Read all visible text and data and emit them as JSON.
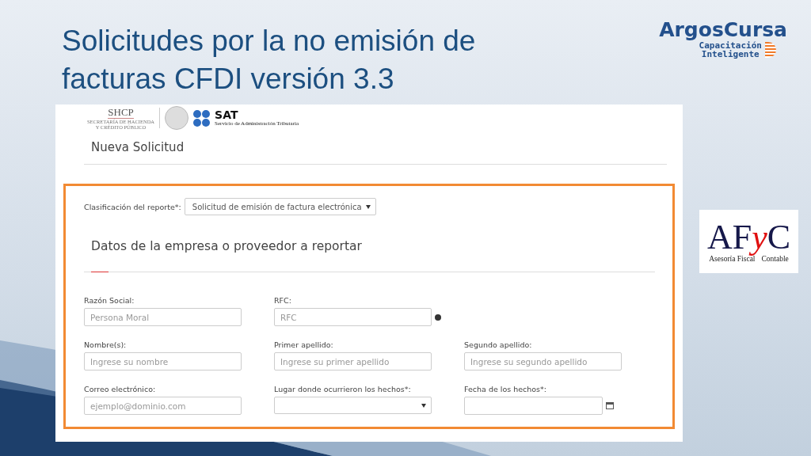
{
  "slide": {
    "title_lines": [
      "Solicitudes por la no emisión de",
      "facturas CFDI versión 3.3"
    ]
  },
  "brand_logo": {
    "name": "ArgosCursa",
    "tagline_lines": [
      "Capacitación",
      "Inteligente"
    ]
  },
  "partner_logo": {
    "mark_left": "AF",
    "mark_middle": "y",
    "mark_right": "C",
    "caption_left": "Asesoría Fiscal",
    "caption_right": "Contable"
  },
  "web_page": {
    "header": {
      "shcp": "SHCP",
      "shcp_caption_lines": [
        "SECRETARÍA DE HACIENDA",
        "Y CRÉDITO PÚBLICO"
      ],
      "sat": "SAT",
      "sat_caption": "Servicio de Administración Tributaria"
    },
    "page_title": "Nueva Solicitud",
    "classification": {
      "label": "Clasificación del reporte*:",
      "value": "Solicitud de emisión de factura electrónica"
    },
    "section_title": "Datos de la empresa o proveedor a reportar",
    "field_rows": [
      [
        {
          "kind": "text",
          "label": "Razón Social:",
          "placeholder": "Persona Moral",
          "has_help": false
        },
        {
          "kind": "text",
          "label": "RFC:",
          "placeholder": "RFC",
          "has_help": true
        }
      ],
      [
        {
          "kind": "text",
          "label": "Nombre(s):",
          "placeholder": "Ingrese su nombre",
          "has_help": false
        },
        {
          "kind": "text",
          "label": "Primer apellido:",
          "placeholder": "Ingrese su primer apellido",
          "has_help": false
        },
        {
          "kind": "text",
          "label": "Segundo apellido:",
          "placeholder": "Ingrese su segundo apellido",
          "has_help": false
        }
      ],
      [
        {
          "kind": "text",
          "label": "Correo electrónico:",
          "placeholder": "ejemplo@dominio.com",
          "has_help": false
        },
        {
          "kind": "select",
          "label": "Lugar donde ocurrieron los hechos*:",
          "has_help": false
        },
        {
          "kind": "date",
          "label": "Fecha de los hechos*:",
          "has_help": false
        }
      ]
    ]
  }
}
